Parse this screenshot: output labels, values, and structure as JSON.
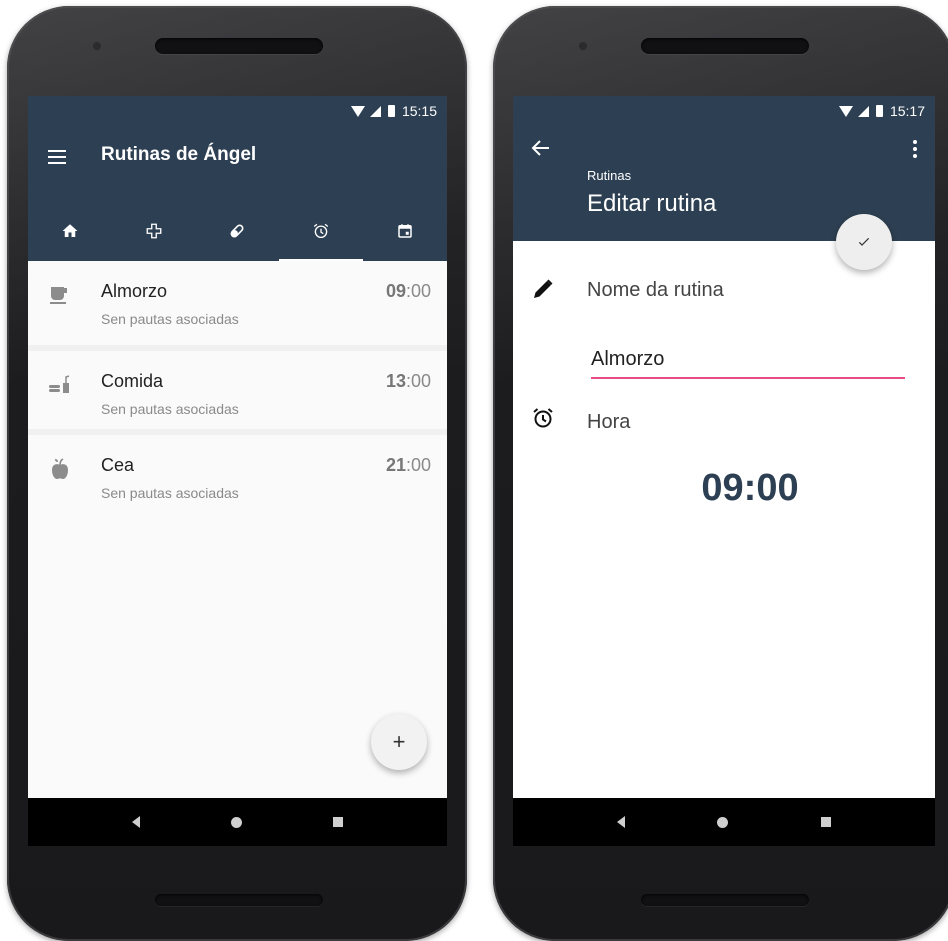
{
  "left_phone": {
    "status": {
      "time": "15:15"
    },
    "appbar": {
      "title": "Rutinas de Ángel"
    },
    "tabs": [
      {
        "icon": "home-icon"
      },
      {
        "icon": "medical-cross-icon"
      },
      {
        "icon": "pill-icon"
      },
      {
        "icon": "alarm-clock-icon",
        "active": true
      },
      {
        "icon": "calendar-icon"
      }
    ],
    "routines": [
      {
        "name": "Almorzo",
        "subtitle": "Sen pautas asociadas",
        "hour": "09",
        "minutes": ":00",
        "icon": "coffee-cup-icon"
      },
      {
        "name": "Comida",
        "subtitle": "Sen pautas asociadas",
        "hour": "13",
        "minutes": ":00",
        "icon": "meal-icon"
      },
      {
        "name": "Cea",
        "subtitle": "Sen pautas asociadas",
        "hour": "21",
        "minutes": ":00",
        "icon": "apple-icon"
      }
    ],
    "fab": {
      "label": "+"
    }
  },
  "right_phone": {
    "status": {
      "time": "15:17"
    },
    "appbar": {
      "subtitle": "Rutinas",
      "title": "Editar rutina"
    },
    "form": {
      "name_label": "Nome da rutina",
      "name_value": "Almorzo",
      "hour_label": "Hora",
      "hour_value": "09:00"
    }
  },
  "colors": {
    "primary": "#2d3f52",
    "accent": "#e84c86",
    "background": "#fafafa"
  }
}
